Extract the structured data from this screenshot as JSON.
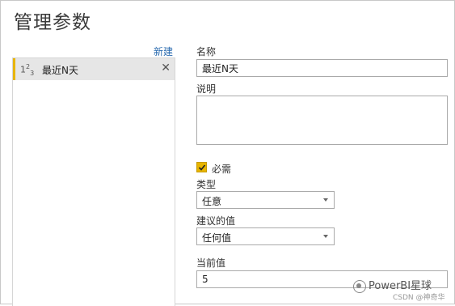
{
  "window": {
    "title": "管理参数"
  },
  "left": {
    "new_label": "新建",
    "params": [
      {
        "icon_text": "1²3",
        "name": "最近N天"
      }
    ]
  },
  "right": {
    "name_label": "名称",
    "name_value": "最近N天",
    "desc_label": "说明",
    "desc_value": "",
    "required_label": "必需",
    "required_checked": true,
    "type_label": "类型",
    "type_value": "任意",
    "suggested_label": "建议的值",
    "suggested_value": "任何值",
    "current_label": "当前值",
    "current_value": "5"
  },
  "watermark": {
    "text": "PowerBI星球",
    "sub": "CSDN @神奇华"
  },
  "colors": {
    "accent": "#e8b500",
    "link": "#2b6cb0"
  }
}
